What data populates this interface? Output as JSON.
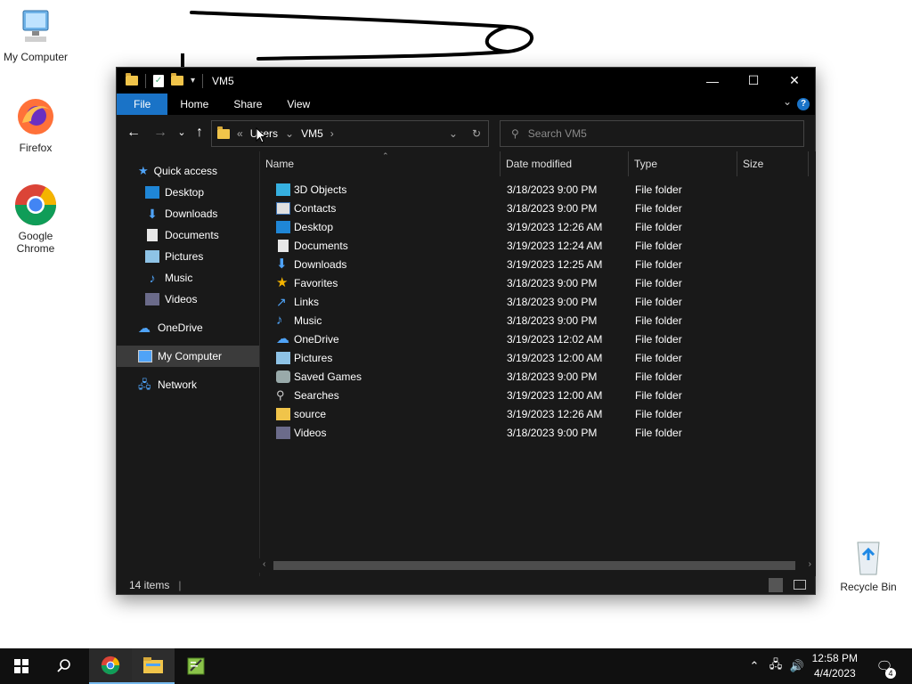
{
  "desktop": {
    "icons": [
      {
        "label": "My Computer"
      },
      {
        "label": "Firefox"
      },
      {
        "label": "Google Chrome"
      }
    ],
    "recycle_bin": "Recycle Bin"
  },
  "window": {
    "title": "VM5",
    "ribbon_tabs": [
      "File",
      "Home",
      "Share",
      "View"
    ],
    "address": {
      "overflow": "«",
      "segments": [
        "Users",
        "VM5"
      ]
    },
    "search_placeholder": "Search VM5",
    "nav_pane": {
      "quick_access": "Quick access",
      "quick_items": [
        {
          "label": "Desktop",
          "pinned": true
        },
        {
          "label": "Downloads",
          "pinned": true
        },
        {
          "label": "Documents",
          "pinned": true
        },
        {
          "label": "Pictures",
          "pinned": true
        },
        {
          "label": "Music",
          "pinned": false
        },
        {
          "label": "Videos",
          "pinned": false
        }
      ],
      "onedrive": "OneDrive",
      "my_computer": "My Computer",
      "network": "Network"
    },
    "columns": [
      "Name",
      "Date modified",
      "Type",
      "Size"
    ],
    "files": [
      {
        "name": "3D Objects",
        "date": "3/18/2023 9:00 PM",
        "type": "File folder",
        "icon": "3d-objects-icon"
      },
      {
        "name": "Contacts",
        "date": "3/18/2023 9:00 PM",
        "type": "File folder",
        "icon": "contacts-icon"
      },
      {
        "name": "Desktop",
        "date": "3/19/2023 12:26 AM",
        "type": "File folder",
        "icon": "desktop-icon"
      },
      {
        "name": "Documents",
        "date": "3/19/2023 12:24 AM",
        "type": "File folder",
        "icon": "documents-icon"
      },
      {
        "name": "Downloads",
        "date": "3/19/2023 12:25 AM",
        "type": "File folder",
        "icon": "downloads-icon"
      },
      {
        "name": "Favorites",
        "date": "3/18/2023 9:00 PM",
        "type": "File folder",
        "icon": "favorites-icon"
      },
      {
        "name": "Links",
        "date": "3/18/2023 9:00 PM",
        "type": "File folder",
        "icon": "links-icon"
      },
      {
        "name": "Music",
        "date": "3/18/2023 9:00 PM",
        "type": "File folder",
        "icon": "music-icon"
      },
      {
        "name": "OneDrive",
        "date": "3/19/2023 12:02 AM",
        "type": "File folder",
        "icon": "onedrive-icon"
      },
      {
        "name": "Pictures",
        "date": "3/19/2023 12:00 AM",
        "type": "File folder",
        "icon": "pictures-icon"
      },
      {
        "name": "Saved Games",
        "date": "3/18/2023 9:00 PM",
        "type": "File folder",
        "icon": "saved-games-icon"
      },
      {
        "name": "Searches",
        "date": "3/19/2023 12:00 AM",
        "type": "File folder",
        "icon": "searches-icon"
      },
      {
        "name": "source",
        "date": "3/19/2023 12:26 AM",
        "type": "File folder",
        "icon": "folder-icon"
      },
      {
        "name": "Videos",
        "date": "3/18/2023 9:00 PM",
        "type": "File folder",
        "icon": "videos-icon"
      }
    ],
    "status": "14 items"
  },
  "taskbar": {
    "clock_time": "12:58 PM",
    "clock_date": "4/4/2023",
    "notifications": "4"
  },
  "colors": {
    "accent": "#1a73c7",
    "window_bg": "#191919",
    "titlebar_bg": "#000000",
    "taskbar_bg": "#101010",
    "folder": "#f0c44a"
  }
}
